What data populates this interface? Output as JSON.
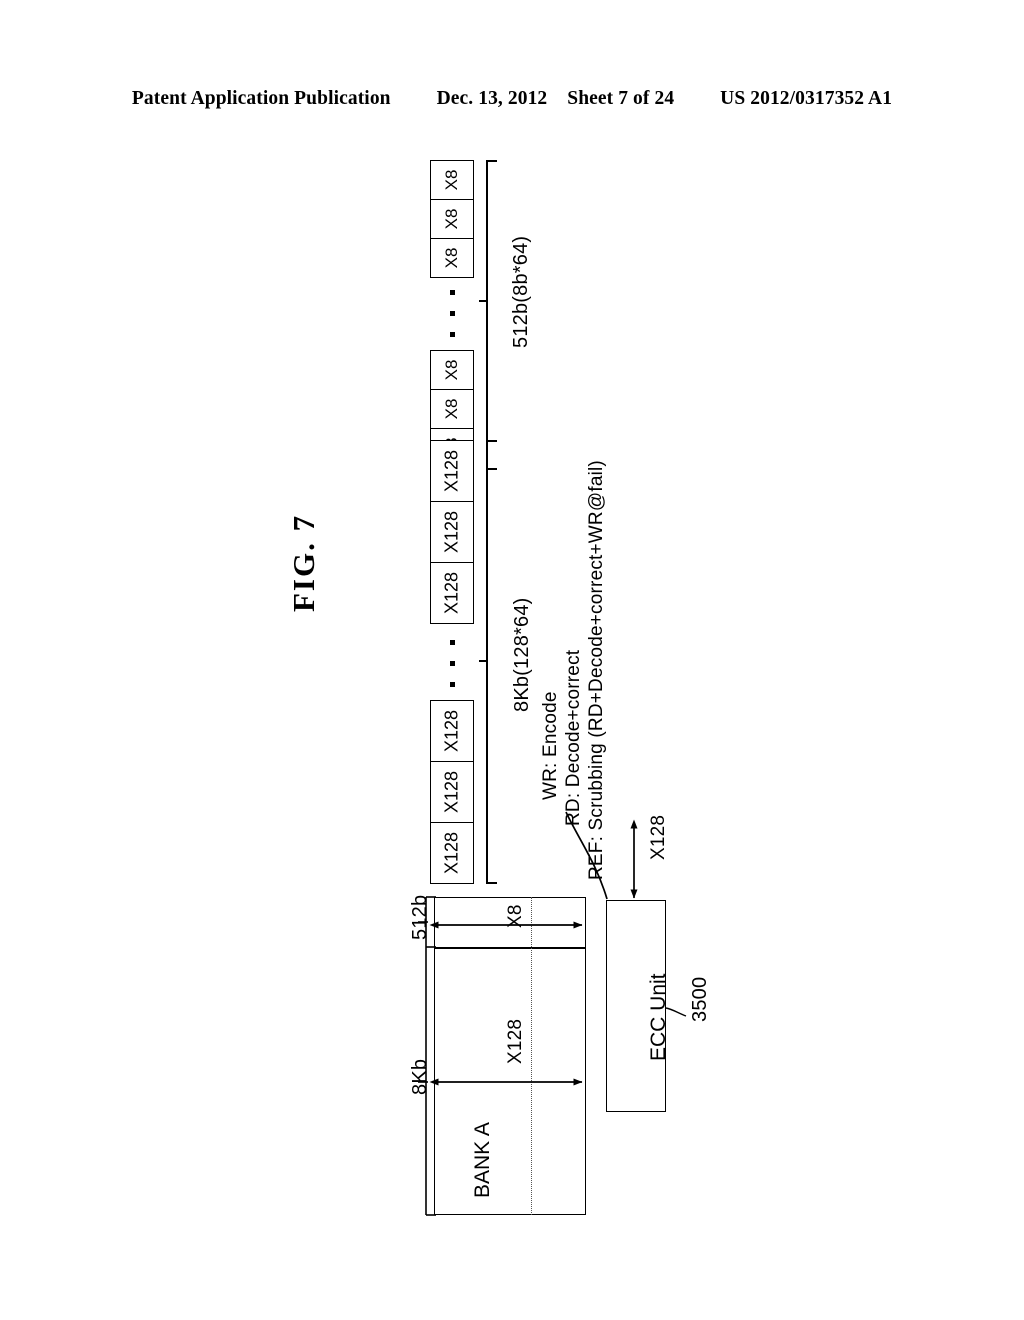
{
  "header": {
    "publication": "Patent Application Publication",
    "date": "Dec. 13, 2012",
    "sheet": "Sheet 7 of 24",
    "docnum": "US 2012/0317352 A1"
  },
  "figure": {
    "title": "FIG. 7"
  },
  "data_row": {
    "label": "8Kb(128*64)",
    "cells_left": [
      "X128",
      "X128",
      "X128"
    ],
    "cells_right": [
      "X128",
      "X128",
      "X128"
    ],
    "ellipsis": "· · ·"
  },
  "parity_row": {
    "label": "512b(8b*64)",
    "cells_left": [
      "X8",
      "X8",
      "X8"
    ],
    "cells_right": [
      "X8",
      "X8",
      "X8"
    ],
    "ellipsis": "· · ·"
  },
  "operations": {
    "wr": "WR: Encode",
    "rd": "RD: Decode+correct",
    "ref": "REF: Scrubbing (RD+Decode+correct+WR@fail)"
  },
  "bank": {
    "name": "BANK A",
    "height_label": "8Kb",
    "parity_label": "512b",
    "data_width": "X128",
    "parity_width": "X8"
  },
  "ecc": {
    "name": "ECC Unit",
    "reference": "3500",
    "bus_label": "X128"
  },
  "colors": {
    "ink": "#000000",
    "paper": "#ffffff"
  }
}
